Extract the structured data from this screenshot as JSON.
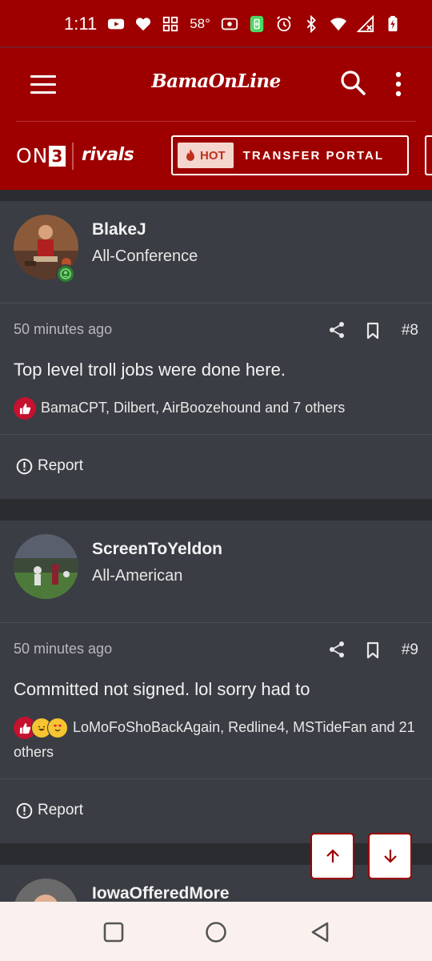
{
  "status_bar": {
    "time": "1:11",
    "temperature": "58°",
    "icons": [
      "youtube-icon",
      "heart-icon",
      "widget-icon",
      "temperature",
      "sound-icon",
      "battery-saver-icon",
      "alarm-icon",
      "bluetooth-icon",
      "wifi-icon",
      "signal-icon",
      "battery-charging-icon"
    ]
  },
  "header": {
    "brand": "BamaOnLine",
    "menu_icon": "hamburger-icon",
    "search_icon": "search-icon",
    "more_icon": "more-vertical-icon"
  },
  "sub_header": {
    "on3_text": "ON",
    "on3_number": "3",
    "rivals_text": "rivals",
    "hot_label": "HOT",
    "portal_label": "TRANSFER PORTAL"
  },
  "posts": [
    {
      "username": "BlakeJ",
      "rank": "All-Conference",
      "time": "50 minutes ago",
      "number": "#8",
      "text": "Top level troll jobs were done here.",
      "reactions": "BamaCPT, Dilbert, AirBoozehound and 7 others",
      "report_label": "Report"
    },
    {
      "username": "ScreenToYeldon",
      "rank": "All-American",
      "time": "50 minutes ago",
      "number": "#9",
      "text": "Committed not signed. lol sorry had to",
      "reactions": "LoMoFoShoBackAgain, Redline4, MSTideFan and 21 others",
      "report_label": "Report"
    },
    {
      "username": "IowaOfferedMore"
    }
  ],
  "colors": {
    "brand_red": "#9e0000",
    "card_bg": "#3a3d43",
    "page_bg": "#2a2c30",
    "nav_bg": "#faf1ef"
  }
}
